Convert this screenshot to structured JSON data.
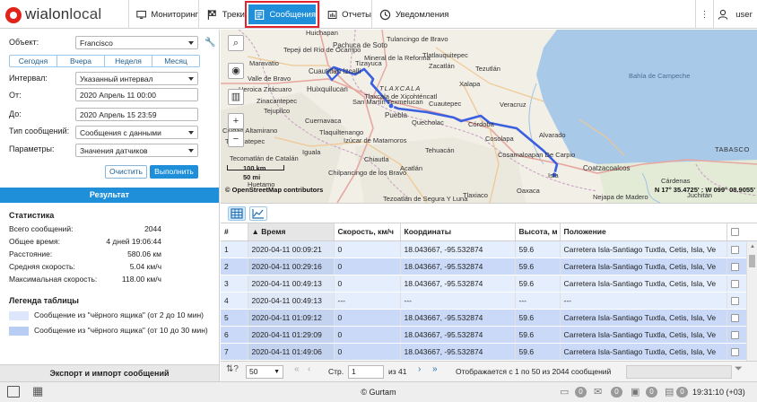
{
  "brand": {
    "word1": "wialon",
    "word2": "local"
  },
  "nav": {
    "monitoring": "Мониторинг",
    "tracks": "Треки",
    "messages": "Сообщения",
    "reports": "Отчеты",
    "notifications": "Уведомления",
    "user": "user"
  },
  "form": {
    "object_label": "Объект:",
    "object_value": "Francisco",
    "periods": [
      "Сегодня",
      "Вчера",
      "Неделя",
      "Месяц"
    ],
    "interval_label": "Интервал:",
    "interval_value": "Указанный интервал",
    "from_label": "От:",
    "from_value": "2020 Апрель 11 00:00",
    "to_label": "До:",
    "to_value": "2020 Апрель 15 23:59",
    "msgtype_label": "Тип сообщений:",
    "msgtype_value": "Сообщения с данными",
    "params_label": "Параметры:",
    "params_value": "Значения датчиков",
    "clear_button": "Очистить",
    "run_button": "Выполнить"
  },
  "result": {
    "title": "Результат",
    "stats_heading": "Статистика",
    "stats": [
      {
        "label": "Всего сообщений:",
        "value": "2044"
      },
      {
        "label": "Общее время:",
        "value": "4 дней 19:06:44"
      },
      {
        "label": "Расстояние:",
        "value": "580.06 км"
      },
      {
        "label": "Средняя скорость:",
        "value": "5.04 км/ч"
      },
      {
        "label": "Максимальная скорость:",
        "value": "118.00 км/ч"
      }
    ],
    "legend_heading": "Легенда таблицы",
    "legend": [
      {
        "text": "Сообщение из \"чёрного ящика\" (от 2 до 10 мин)",
        "color": "#dde6fb"
      },
      {
        "text": "Сообщение из \"чёрного ящика\" (от 10 до 30 мин)",
        "color": "#b8cdf4"
      }
    ],
    "export": "Экспорт и импорт сообщений"
  },
  "map": {
    "labels": [
      "Huichapan",
      "Pachuca de Soto",
      "Maravatio",
      "Cuautitlán Izcalli",
      "Zacatlán",
      "Tezutlán",
      "Huixquilucan",
      "TLAXCALA",
      "Xalapa",
      "Heroica Zitácuaro",
      "Puebla",
      "Veracruz",
      "Bahía de Campeche",
      "Cuernavaca",
      "Quecholac",
      "Córdoba",
      "Cosolapa",
      "Tlaxiaco",
      "Izúcar de Matamoros",
      "Tehuacán",
      "Iguala",
      "Cosamaloapan De Carpio",
      "Isla",
      "Coatzacoalcos",
      "Cárdenas",
      "TABASCO",
      "Ciudad Altamirano",
      "Chilpancingo de los Bravo",
      "Tezoatlán de Segura Y Luna",
      "Tepalcatepec",
      "Cuautepec",
      "Tlatlauquitepec",
      "San Martín Texmelucan",
      "Alvarado",
      "Acatlán",
      "Nejapa de Madero",
      "Tecomatlán de Catalán",
      "Tejupilco",
      "Huetamo",
      "Mineral de la Reforma",
      "Tepeji del Río de Ocampo",
      "Tizayuca",
      "Tulancingo de Bravo",
      "Tlaxcala de Xicohténcatl",
      "Zinacantepec",
      "Valle de Bravo",
      "Tlaquiltenango",
      "Chiautla",
      "Oaxaca",
      "Juchitán"
    ],
    "scale_km": "100 km",
    "scale_mi": "50 mi",
    "attribution": "© OpenStreetMap contributors",
    "coords": "N 17° 35.4725' : W 099° 08.9055'"
  },
  "table": {
    "columns": [
      "#",
      "Время",
      "Скорость, км/ч",
      "Координаты",
      "Высота, м",
      "Положение"
    ],
    "rows": [
      {
        "n": "1",
        "time": "2020-04-11 00:09:21",
        "speed": "0",
        "coords": "18.043667, -95.532874",
        "alt": "59.6",
        "pos": "Carretera Isla-Santiago Tuxtla, Cetis, Isla, Ve"
      },
      {
        "n": "2",
        "time": "2020-04-11 00:29:16",
        "speed": "0",
        "coords": "18.043667, -95.532874",
        "alt": "59.6",
        "pos": "Carretera Isla-Santiago Tuxtla, Cetis, Isla, Ve"
      },
      {
        "n": "3",
        "time": "2020-04-11 00:49:13",
        "speed": "0",
        "coords": "18.043667, -95.532874",
        "alt": "59.6",
        "pos": "Carretera Isla-Santiago Tuxtla, Cetis, Isla, Ve"
      },
      {
        "n": "4",
        "time": "2020-04-11 00:49:13",
        "speed": "---",
        "coords": "---",
        "alt": "---",
        "pos": "---"
      },
      {
        "n": "5",
        "time": "2020-04-11 01:09:12",
        "speed": "0",
        "coords": "18.043667, -95.532874",
        "alt": "59.6",
        "pos": "Carretera Isla-Santiago Tuxtla, Cetis, Isla, Ve"
      },
      {
        "n": "6",
        "time": "2020-04-11 01:29:09",
        "speed": "0",
        "coords": "18.043667, -95.532874",
        "alt": "59.6",
        "pos": "Carretera Isla-Santiago Tuxtla, Cetis, Isla, Ve"
      },
      {
        "n": "7",
        "time": "2020-04-11 01:49:06",
        "speed": "0",
        "coords": "18.043667, -95.532874",
        "alt": "59.6",
        "pos": "Carretera Isla-Santiago Tuxtla, Cetis, Isla, Ve"
      }
    ]
  },
  "pager": {
    "page_size": "50",
    "page_label": "Стр.",
    "page_value": "1",
    "of_pages": "из 41",
    "summary": "Отображается с 1 по 50 из 2044 сообщений"
  },
  "footer": {
    "copyright": "© Gurtam",
    "badges": [
      "0",
      "0",
      "0",
      "0"
    ],
    "clock": "19:31:10 (+03)"
  },
  "colors": {
    "accent": "#1f8fda",
    "highlight": "#e0242c",
    "track": "#3a5fe0"
  }
}
